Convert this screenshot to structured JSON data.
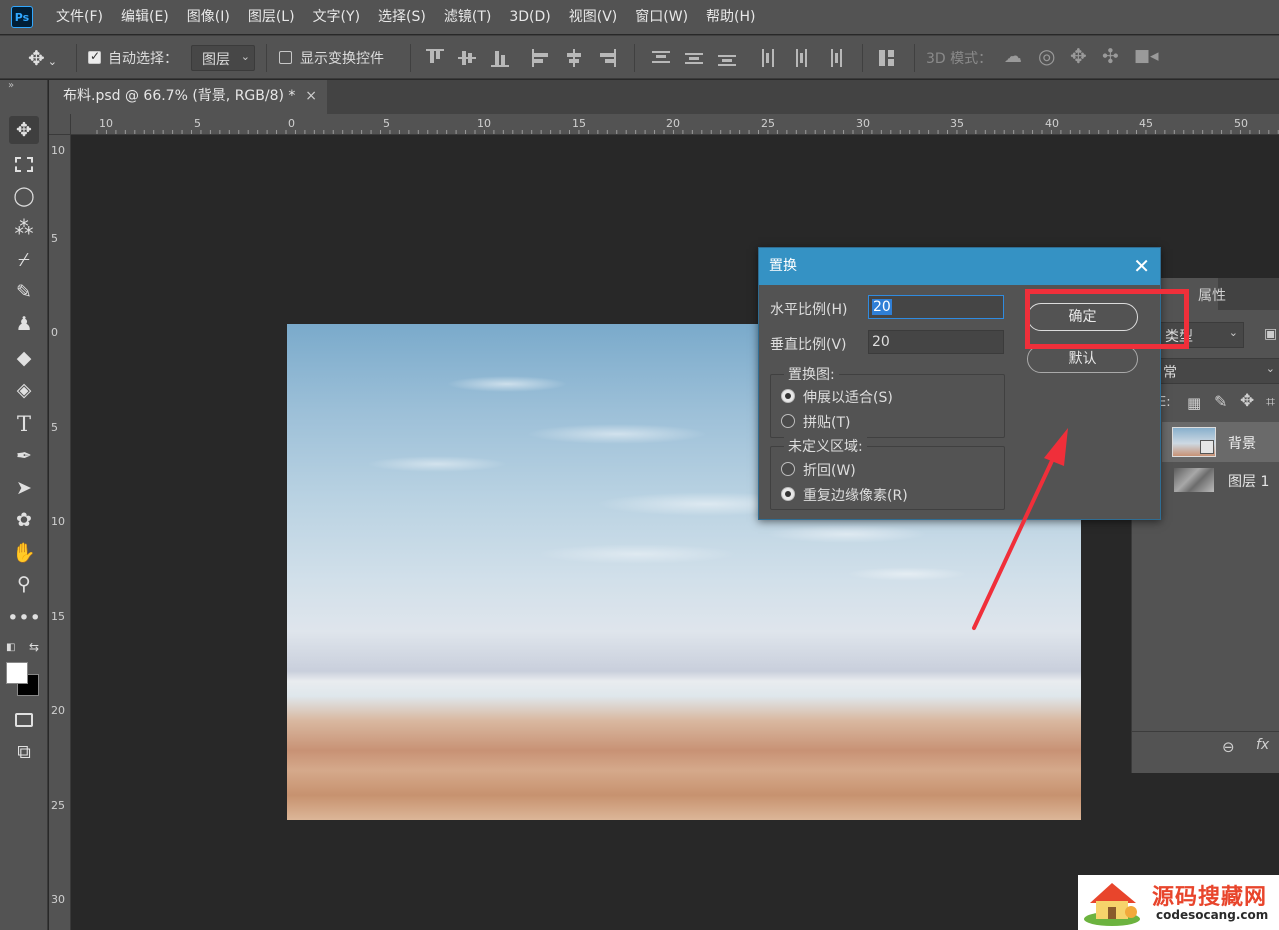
{
  "app": {
    "logo_text": "Ps",
    "menu": [
      "文件(F)",
      "编辑(E)",
      "图像(I)",
      "图层(L)",
      "文字(Y)",
      "选择(S)",
      "滤镜(T)",
      "3D(D)",
      "视图(V)",
      "窗口(W)",
      "帮助(H)"
    ]
  },
  "options_bar": {
    "auto_select_label": "自动选择：",
    "auto_select_checked": true,
    "auto_select_target": "图层",
    "show_transform_label": "显示变换控件",
    "show_transform_checked": false,
    "mode_3d_label": "3D 模式："
  },
  "document": {
    "tab_title": "布料.psd @ 66.7% (背景, RGB/8) *",
    "close_glyph": "×"
  },
  "rulers": {
    "horizontal": [
      "10",
      "5",
      "0",
      "5",
      "10",
      "15",
      "20",
      "25",
      "30",
      "35",
      "40",
      "45",
      "50"
    ],
    "vertical": [
      "10",
      "5",
      "0",
      "5",
      "10",
      "15",
      "20",
      "25",
      "30"
    ]
  },
  "dialog": {
    "title": "置换",
    "close_glyph": "✕",
    "horizontal_scale_label": "水平比例(H)",
    "horizontal_scale_value": "20",
    "vertical_scale_label": "垂直比例(V)",
    "vertical_scale_value": "20",
    "displacement_map_title": "置换图:",
    "stretch_to_fit_label": "伸展以适合(S)",
    "stretch_to_fit_selected": true,
    "tile_label": "拼贴(T)",
    "tile_selected": false,
    "undefined_areas_title": "未定义区域:",
    "wrap_around_label": "折回(W)",
    "wrap_around_selected": false,
    "repeat_edge_label": "重复边缘像素(R)",
    "repeat_edge_selected": true,
    "ok_label": "确定",
    "default_label": "默认"
  },
  "layers_panel": {
    "tab_properties": "属性",
    "filter_label": "类型",
    "blend_mode": "常",
    "lock_label": "E:",
    "layers": [
      {
        "name": "背景",
        "selected": true
      },
      {
        "name": "图层 1",
        "selected": false
      }
    ],
    "fx_label": "fx"
  },
  "watermark": {
    "title": "源码搜藏网",
    "url": "codesocang.com"
  },
  "colors": {
    "accent": "#3592c4",
    "annotation_red": "#f02f3a",
    "panel": "#535353",
    "workspace": "#282828"
  }
}
